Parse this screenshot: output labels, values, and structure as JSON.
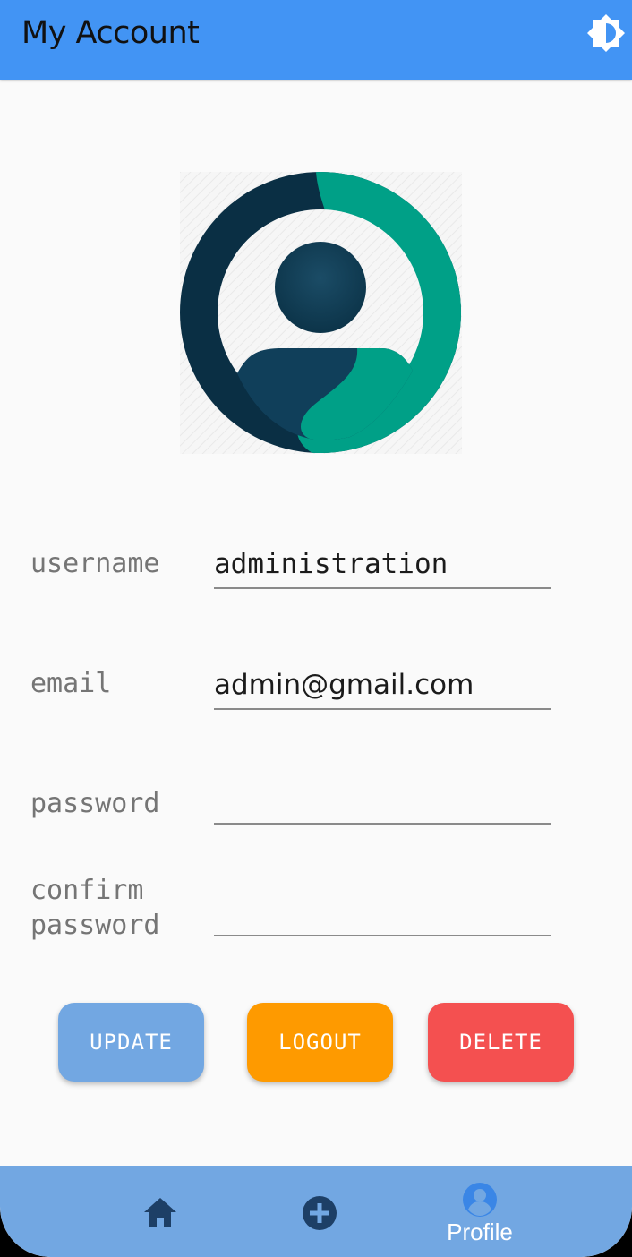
{
  "app": {
    "title": "My Account"
  },
  "icons": {
    "theme": "brightness-icon",
    "home": "home-icon",
    "add": "add-circle-icon",
    "profile": "account-circle-icon"
  },
  "colors": {
    "appbar": "#4294f4",
    "update": "#72a7e2",
    "logout": "#fe9a00",
    "delete": "#f45050",
    "nav": "#72a7e2",
    "avatar_dark": "#0e3a52",
    "avatar_teal": "#00a087"
  },
  "form": {
    "username": {
      "label": "username",
      "value": "administration"
    },
    "email": {
      "label": "email",
      "value": "admin@gmail.com"
    },
    "password": {
      "label": "password",
      "value": ""
    },
    "confirm_password": {
      "label": "confirm\npassword",
      "value": ""
    }
  },
  "buttons": {
    "update": "UPDATE",
    "logout": "LOGOUT",
    "delete": "DELETE"
  },
  "nav": {
    "active_label": "Profile"
  }
}
